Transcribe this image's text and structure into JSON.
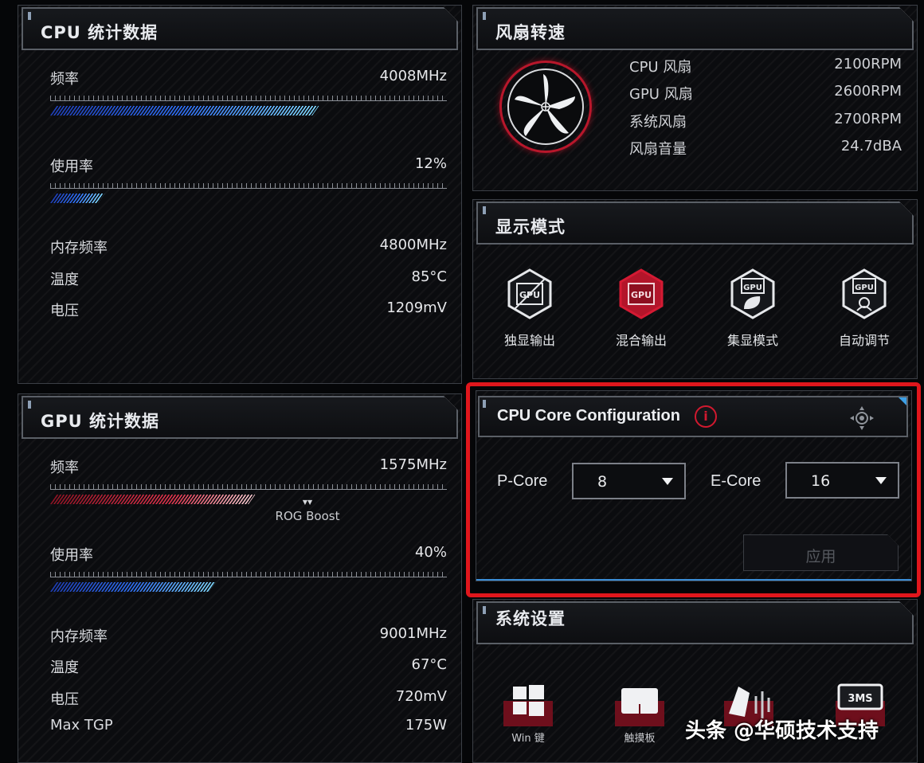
{
  "cpu_panel": {
    "title": "CPU 统计数据",
    "frequency_label": "频率",
    "frequency_value": "4008MHz",
    "frequency_level": 0.66,
    "usage_label": "使用率",
    "usage_value": "12%",
    "usage_level": 0.12,
    "mem_freq_label": "内存频率",
    "mem_freq_value": "4800MHz",
    "temp_label": "温度",
    "temp_value": "85°C",
    "voltage_label": "电压",
    "voltage_value": "1209mV"
  },
  "gpu_panel": {
    "title": "GPU 统计数据",
    "frequency_label": "频率",
    "frequency_value": "1575MHz",
    "frequency_level": 0.5,
    "boost_label": "ROG Boost",
    "usage_label": "使用率",
    "usage_value": "40%",
    "usage_level": 0.4,
    "mem_freq_label": "内存频率",
    "mem_freq_value": "9001MHz",
    "temp_label": "温度",
    "temp_value": "67°C",
    "voltage_label": "电压",
    "voltage_value": "720mV",
    "tgp_label": "Max TGP",
    "tgp_value": "175W"
  },
  "fan_panel": {
    "title": "风扇转速",
    "rows": [
      {
        "label": "CPU 风扇",
        "value": "2100RPM"
      },
      {
        "label": "GPU 风扇",
        "value": "2600RPM"
      },
      {
        "label": "系统风扇",
        "value": "2700RPM"
      },
      {
        "label": "风扇音量",
        "value": "24.7dBA"
      }
    ]
  },
  "display_panel": {
    "title": "显示模式",
    "icon_text": "GPU",
    "modes": [
      {
        "label": "独显输出",
        "icon": "gpu-discrete-icon",
        "active": false
      },
      {
        "label": "混合输出",
        "icon": "gpu-hybrid-icon",
        "active": true
      },
      {
        "label": "集显模式",
        "icon": "gpu-eco-icon",
        "active": false
      },
      {
        "label": "自动调节",
        "icon": "gpu-auto-icon",
        "active": false
      }
    ]
  },
  "core_config": {
    "title": "CPU Core Configuration",
    "info_icon_text": "i",
    "pcore_label": "P-Core",
    "pcore_value": "8",
    "ecore_label": "E-Core",
    "ecore_value": "16",
    "apply_label": "应用",
    "highlight_color": "#e0161c"
  },
  "system_panel": {
    "title": "系统设置",
    "items": [
      {
        "label": "Win 键",
        "icon": "windows-key-icon"
      },
      {
        "label": "触摸板",
        "icon": "touchpad-icon"
      },
      {
        "label": "",
        "icon": "boot-sound-icon"
      },
      {
        "label": "",
        "icon": "bms-icon"
      }
    ],
    "bms_text": "3MS"
  },
  "watermark": "头条 @华硕技术支持",
  "colors": {
    "accent_red": "#c8172d",
    "accent_blue": "#2f6ef0",
    "highlight": "#e0161c"
  }
}
